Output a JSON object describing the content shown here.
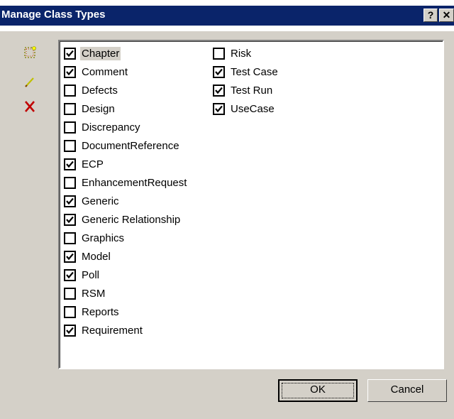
{
  "window": {
    "title": "Manage Class Types",
    "help_glyph": "?",
    "close_glyph": "✕"
  },
  "toolbar": {
    "tools": [
      {
        "name": "new-icon"
      },
      {
        "name": "edit-pencil-icon"
      },
      {
        "name": "delete-x-icon",
        "color": "#c00000"
      }
    ]
  },
  "class_types": {
    "left": [
      {
        "label": "Chapter",
        "checked": true,
        "focused": true
      },
      {
        "label": "Comment",
        "checked": true
      },
      {
        "label": "Defects",
        "checked": false
      },
      {
        "label": "Design",
        "checked": false
      },
      {
        "label": "Discrepancy",
        "checked": false
      },
      {
        "label": "DocumentReference",
        "checked": false
      },
      {
        "label": "ECP",
        "checked": true
      },
      {
        "label": "EnhancementRequest",
        "checked": false
      },
      {
        "label": "Generic",
        "checked": true
      },
      {
        "label": "Generic Relationship",
        "checked": true
      },
      {
        "label": "Graphics",
        "checked": false
      },
      {
        "label": "Model",
        "checked": true
      },
      {
        "label": "Poll",
        "checked": true
      },
      {
        "label": "RSM",
        "checked": false
      },
      {
        "label": "Reports",
        "checked": false
      },
      {
        "label": "Requirement",
        "checked": true
      }
    ],
    "right": [
      {
        "label": "Risk",
        "checked": false
      },
      {
        "label": "Test Case",
        "checked": true
      },
      {
        "label": "Test Run",
        "checked": true
      },
      {
        "label": "UseCase",
        "checked": true
      }
    ]
  },
  "buttons": {
    "ok": "OK",
    "cancel": "Cancel"
  },
  "colors": {
    "titlebar": "#0a246a",
    "dialog_face": "#d4d0c8"
  }
}
